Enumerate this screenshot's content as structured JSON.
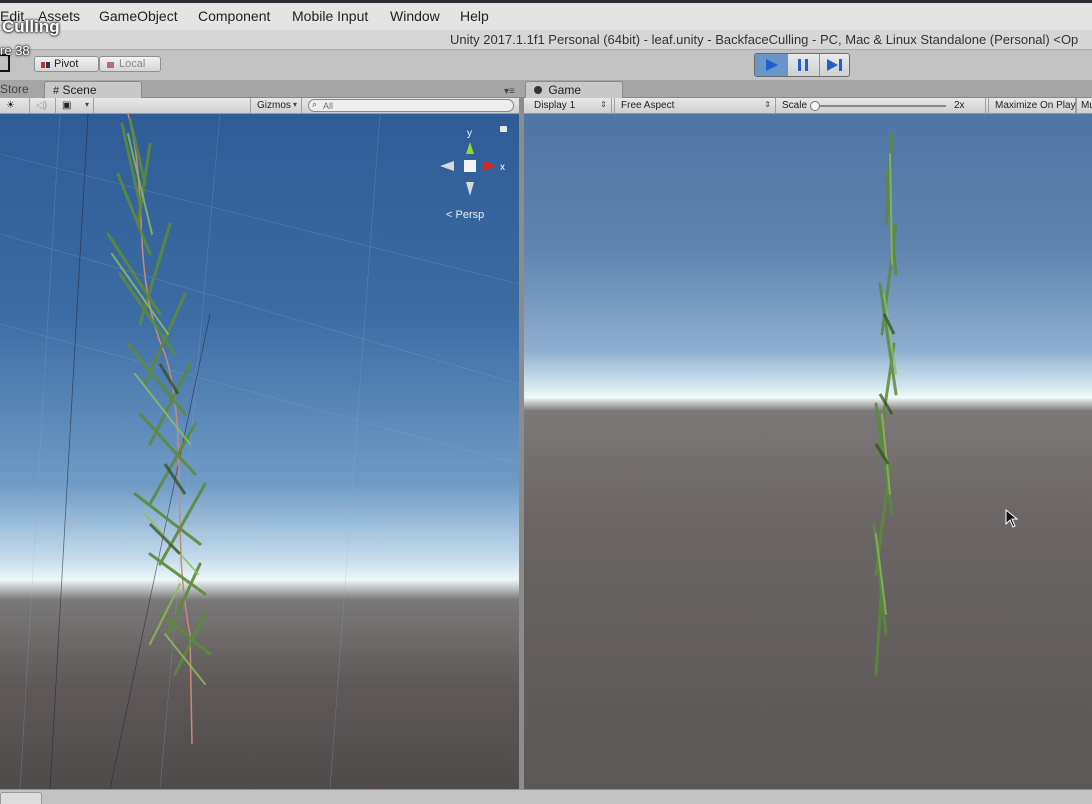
{
  "overlay": {
    "title": "Culling",
    "subtitle": "re 38"
  },
  "menu": {
    "items": [
      "Edit",
      "Assets",
      "GameObject",
      "Component",
      "Mobile Input",
      "Window",
      "Help"
    ]
  },
  "window": {
    "title": "Unity 2017.1.1f1 Personal (64bit) - leaf.unity - BackfaceCulling - PC, Mac & Linux Standalone (Personal) <Op"
  },
  "toolbar": {
    "pivot_label": "Pivot",
    "local_label": "Local",
    "play_color": "#6a95c9"
  },
  "tabs": {
    "store_label": "Store",
    "scene_label": "Scene",
    "game_label": "Game"
  },
  "scene_bar": {
    "gizmos_label": "Gizmos",
    "search_placeholder": "All"
  },
  "game_bar": {
    "display_label": "Display 1",
    "aspect_label": "Free Aspect",
    "scale_label": "Scale",
    "scale_value": "2x",
    "maximize_label": "Maximize On Play",
    "mute_label": "Mu"
  },
  "gizmo": {
    "persp_label": "Persp",
    "y_label": "y",
    "x_label": "x"
  },
  "colors": {
    "gizmo_y": "#8fd82f",
    "gizmo_x": "#d8281d",
    "plant_green": "#5c8a3c"
  }
}
